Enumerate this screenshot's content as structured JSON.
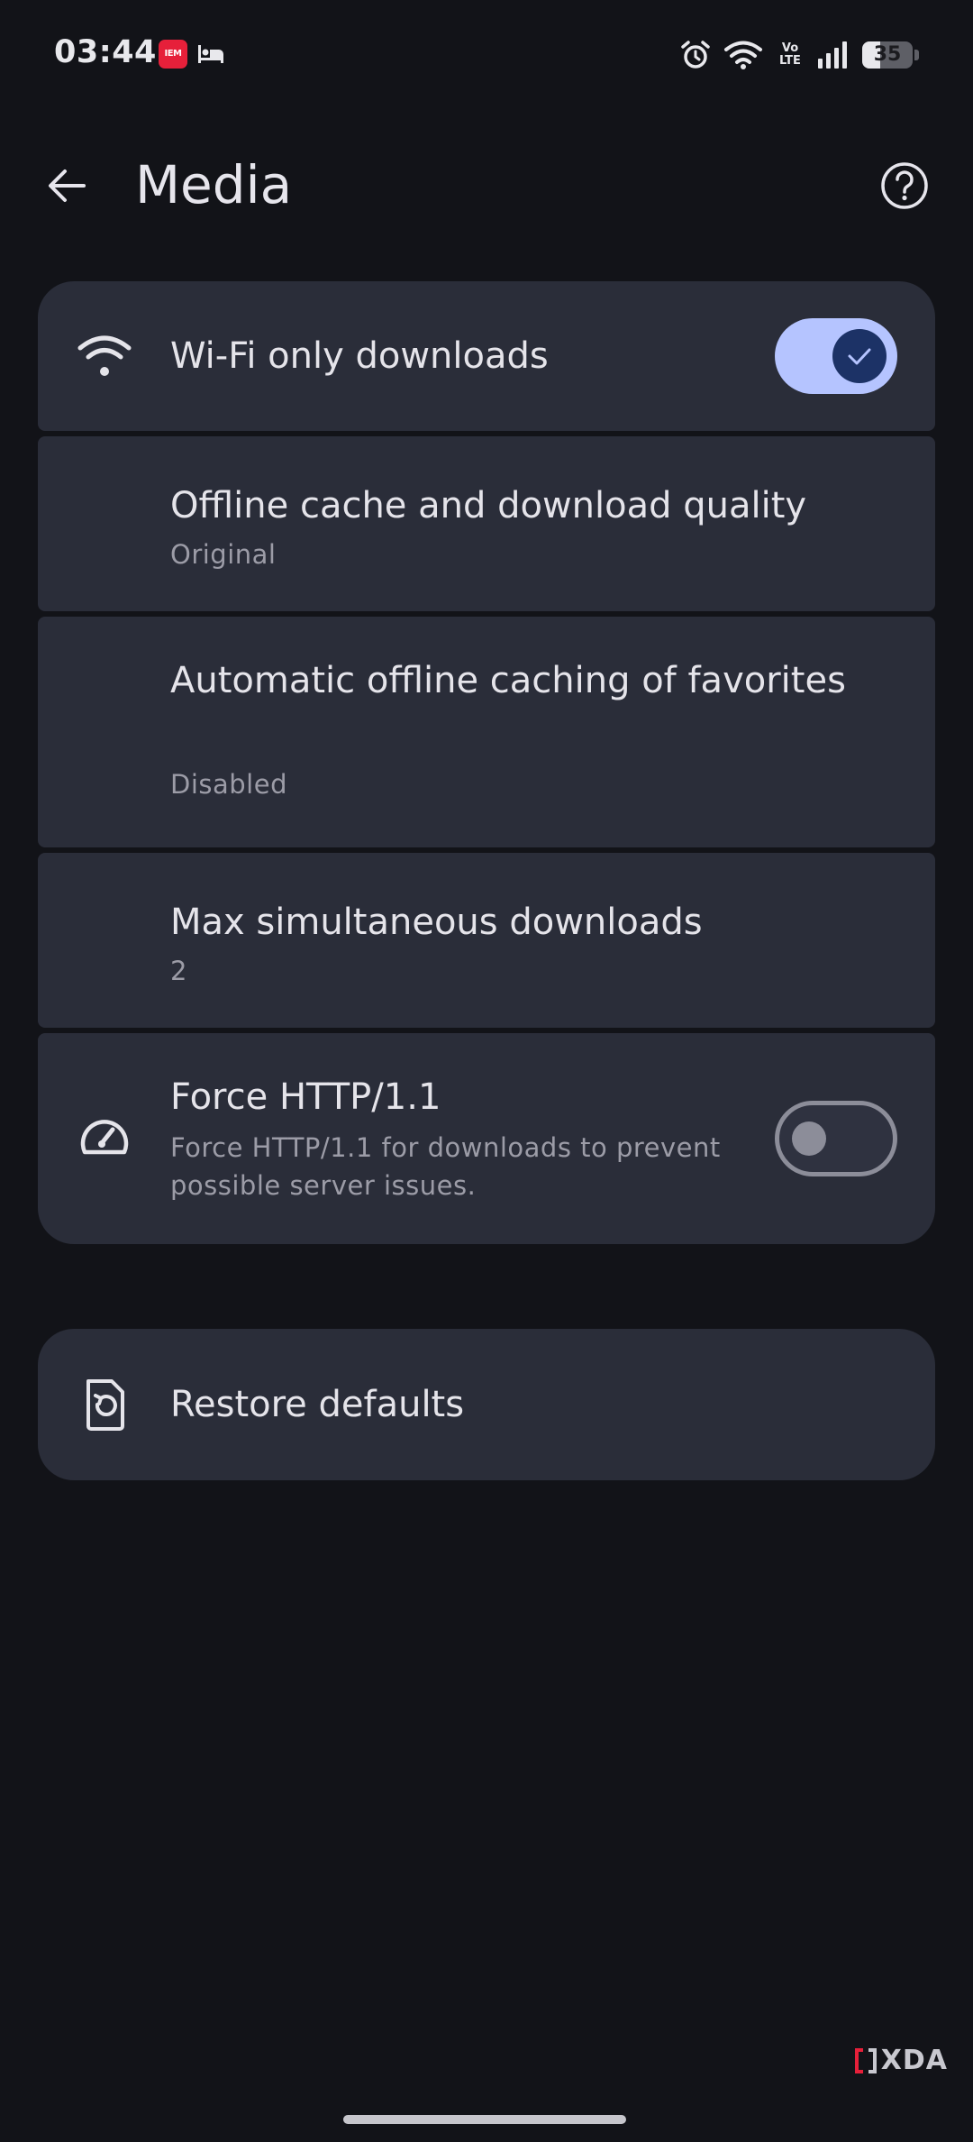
{
  "status_bar": {
    "time": "03:44",
    "app_badge": "IEM",
    "volte": "Vo\nLTE",
    "battery_level": "35",
    "battery_fraction": 0.35,
    "icons": [
      "iem-app-icon",
      "bed-icon",
      "alarm-icon",
      "wifi-icon",
      "volte-icon",
      "signal-icon",
      "battery-icon"
    ]
  },
  "app_bar": {
    "title": "Media",
    "back_icon": "arrow-left-icon",
    "help_icon": "help-circle-icon"
  },
  "settings": {
    "wifi_only": {
      "title": "Wi-Fi only downloads",
      "icon": "wifi-icon",
      "enabled": true
    },
    "quality": {
      "title": "Offline cache and download quality",
      "summary": "Original"
    },
    "favorites": {
      "title": "Automatic offline caching of favorites",
      "summary": "Disabled"
    },
    "max_downloads": {
      "title": "Max simultaneous downloads",
      "summary": "2"
    },
    "force_http": {
      "title": "Force HTTP/1.1",
      "summary": "Force HTTP/1.1 for downloads to prevent possible server issues.",
      "icon": "speedometer-icon",
      "enabled": false
    }
  },
  "restore": {
    "title": "Restore defaults",
    "icon": "restore-file-icon"
  },
  "watermark": {
    "text": "XDA"
  },
  "colors": {
    "background": "#121318",
    "card": "#2a2d39",
    "switch_on_track": "#b5c4ff",
    "switch_on_thumb": "#1c3266",
    "switch_off_outline": "#8c8d99",
    "text_primary": "#e5e4ea",
    "text_secondary": "#9c9ca7"
  }
}
